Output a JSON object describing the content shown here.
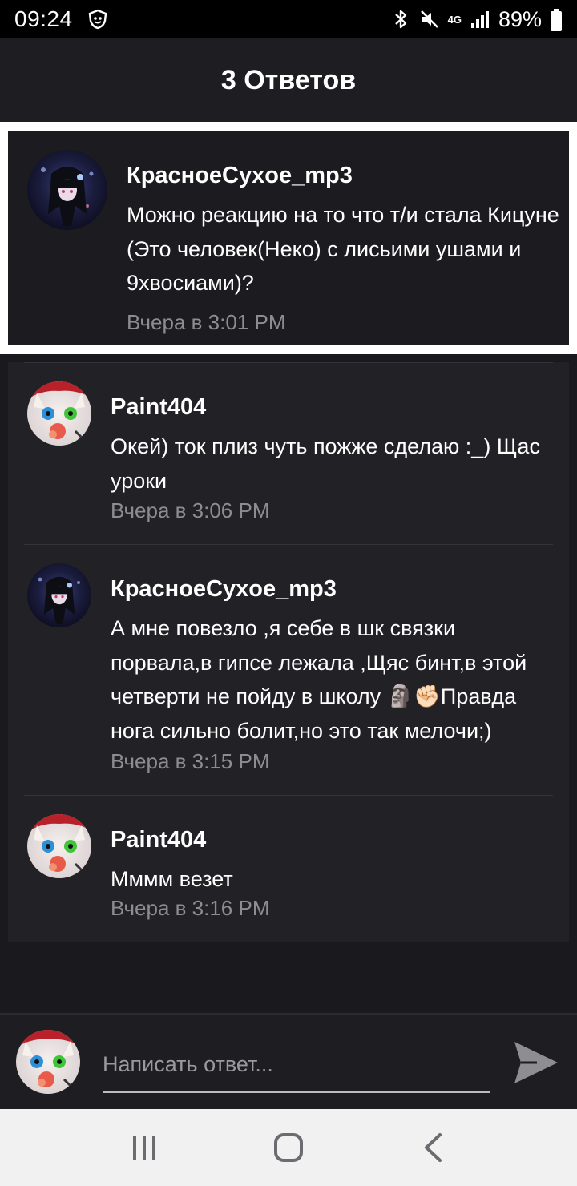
{
  "status_bar": {
    "time": "09:24",
    "network": "4G",
    "battery": "89%"
  },
  "header": {
    "title": "3 Ответов"
  },
  "parent_comment": {
    "author": "КраснoeCyxoe_mp3",
    "text": "Можно реакцию на то что т/и стала Кицуне (Это человек(Неко) с лисьими ушами и 9хвосиами)?",
    "time": "Вчера в 3:01 PM",
    "avatar": "dark-anime-avatar"
  },
  "replies": [
    {
      "author": "Paint404",
      "text": "Окей) ток плиз чуть пожже сделаю :_) Щас уроки",
      "time": "Вчера в 3:06 PM",
      "avatar": "cat-avatar"
    },
    {
      "author": "КраснoeCyxoe_mp3",
      "text": "А мне повезло ,я себе в шк связки порвала,в гипсе лежала ,Щяс бинт,в этой четверти не пойду в школу 🗿✊🏻Правда нога сильно болит,но это так мелочи;)",
      "time": "Вчера в 3:15 PM",
      "avatar": "dark-anime-avatar"
    },
    {
      "author": "Paint404",
      "text": "Мммм везет",
      "time": "Вчера в 3:16 PM",
      "avatar": "cat-avatar"
    }
  ],
  "composer": {
    "placeholder": "Написать ответ...",
    "avatar": "cat-avatar"
  },
  "colors": {
    "background": "#1a191d",
    "card": "#222126",
    "muted_text": "#8d8c91",
    "frame": "#ffffff"
  }
}
